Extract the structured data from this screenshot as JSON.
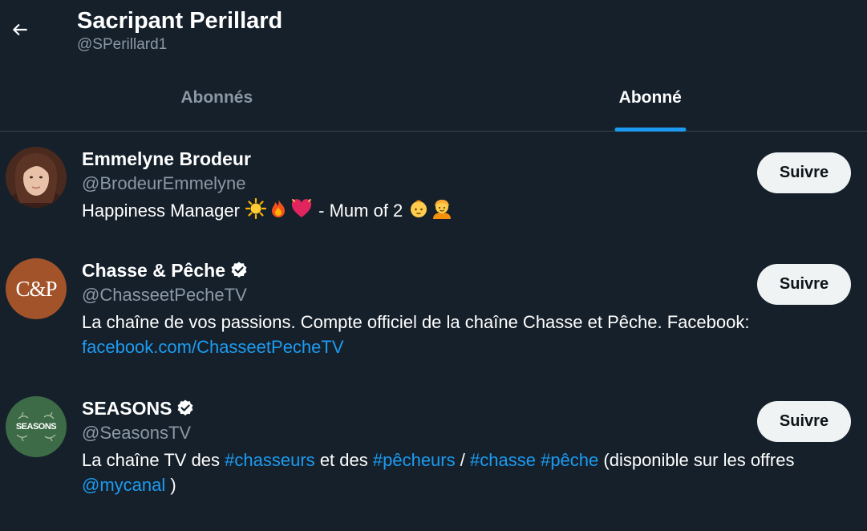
{
  "header": {
    "back_icon": "arrow-left-icon",
    "name": "Sacripant Perillard",
    "handle": "@SPerillard1"
  },
  "tabs": [
    {
      "label": "Abonnés",
      "active": false
    },
    {
      "label": "Abonné",
      "active": true
    }
  ],
  "accent_color": "#1d9bf0",
  "users": [
    {
      "name": "Emmelyne Brodeur",
      "handle": "@BrodeurEmmelyne",
      "verified": false,
      "bio_text": "Happiness Manager",
      "bio_emojis": [
        "sun-emoji",
        "fire-emoji",
        "heart-emoji"
      ],
      "bio_text_2": "- Mum of 2",
      "bio_emojis_2": [
        "baby-emoji",
        "child-emoji"
      ],
      "follow_label": "Suivre"
    },
    {
      "name": "Chasse & Pêche",
      "handle": "@ChasseetPecheTV",
      "verified": true,
      "avatar_text": "C&P",
      "bio_text": "La chaîne de vos passions. Compte officiel de la chaîne Chasse et Pêche. Facebook:",
      "bio_link": "facebook.com/ChasseetPecheTV",
      "follow_label": "Suivre"
    },
    {
      "name": "SEASONS",
      "handle": "@SeasonsTV",
      "verified": true,
      "avatar_text": "SEASONS",
      "bio_part1": "La chaîne TV des",
      "hashtag1": "#chasseurs",
      "bio_part2": "et des",
      "hashtag2": "#pêcheurs",
      "bio_part3": "/",
      "hashtag3": "#chasse",
      "hashtag4": "#pêche",
      "bio_part4": "(disponible sur les offres",
      "mention": "@mycanal",
      "bio_part5": ")",
      "follow_label": "Suivre"
    }
  ]
}
